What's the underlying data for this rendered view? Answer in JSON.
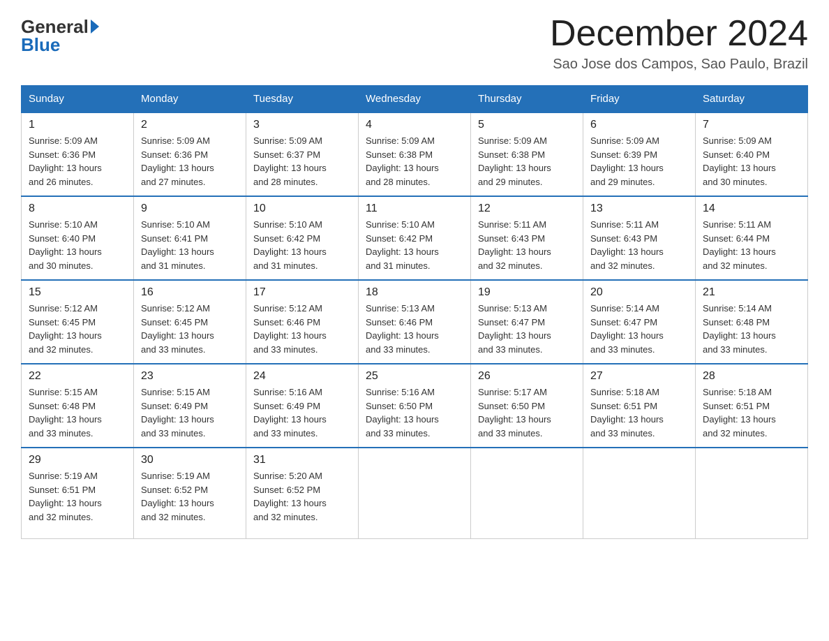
{
  "logo": {
    "text_general": "General",
    "text_blue": "Blue"
  },
  "header": {
    "month_title": "December 2024",
    "location": "Sao Jose dos Campos, Sao Paulo, Brazil"
  },
  "days_of_week": [
    "Sunday",
    "Monday",
    "Tuesday",
    "Wednesday",
    "Thursday",
    "Friday",
    "Saturday"
  ],
  "weeks": [
    [
      {
        "day": "1",
        "sunrise": "5:09 AM",
        "sunset": "6:36 PM",
        "daylight": "13 hours and 26 minutes."
      },
      {
        "day": "2",
        "sunrise": "5:09 AM",
        "sunset": "6:36 PM",
        "daylight": "13 hours and 27 minutes."
      },
      {
        "day": "3",
        "sunrise": "5:09 AM",
        "sunset": "6:37 PM",
        "daylight": "13 hours and 28 minutes."
      },
      {
        "day": "4",
        "sunrise": "5:09 AM",
        "sunset": "6:38 PM",
        "daylight": "13 hours and 28 minutes."
      },
      {
        "day": "5",
        "sunrise": "5:09 AM",
        "sunset": "6:38 PM",
        "daylight": "13 hours and 29 minutes."
      },
      {
        "day": "6",
        "sunrise": "5:09 AM",
        "sunset": "6:39 PM",
        "daylight": "13 hours and 29 minutes."
      },
      {
        "day": "7",
        "sunrise": "5:09 AM",
        "sunset": "6:40 PM",
        "daylight": "13 hours and 30 minutes."
      }
    ],
    [
      {
        "day": "8",
        "sunrise": "5:10 AM",
        "sunset": "6:40 PM",
        "daylight": "13 hours and 30 minutes."
      },
      {
        "day": "9",
        "sunrise": "5:10 AM",
        "sunset": "6:41 PM",
        "daylight": "13 hours and 31 minutes."
      },
      {
        "day": "10",
        "sunrise": "5:10 AM",
        "sunset": "6:42 PM",
        "daylight": "13 hours and 31 minutes."
      },
      {
        "day": "11",
        "sunrise": "5:10 AM",
        "sunset": "6:42 PM",
        "daylight": "13 hours and 31 minutes."
      },
      {
        "day": "12",
        "sunrise": "5:11 AM",
        "sunset": "6:43 PM",
        "daylight": "13 hours and 32 minutes."
      },
      {
        "day": "13",
        "sunrise": "5:11 AM",
        "sunset": "6:43 PM",
        "daylight": "13 hours and 32 minutes."
      },
      {
        "day": "14",
        "sunrise": "5:11 AM",
        "sunset": "6:44 PM",
        "daylight": "13 hours and 32 minutes."
      }
    ],
    [
      {
        "day": "15",
        "sunrise": "5:12 AM",
        "sunset": "6:45 PM",
        "daylight": "13 hours and 32 minutes."
      },
      {
        "day": "16",
        "sunrise": "5:12 AM",
        "sunset": "6:45 PM",
        "daylight": "13 hours and 33 minutes."
      },
      {
        "day": "17",
        "sunrise": "5:12 AM",
        "sunset": "6:46 PM",
        "daylight": "13 hours and 33 minutes."
      },
      {
        "day": "18",
        "sunrise": "5:13 AM",
        "sunset": "6:46 PM",
        "daylight": "13 hours and 33 minutes."
      },
      {
        "day": "19",
        "sunrise": "5:13 AM",
        "sunset": "6:47 PM",
        "daylight": "13 hours and 33 minutes."
      },
      {
        "day": "20",
        "sunrise": "5:14 AM",
        "sunset": "6:47 PM",
        "daylight": "13 hours and 33 minutes."
      },
      {
        "day": "21",
        "sunrise": "5:14 AM",
        "sunset": "6:48 PM",
        "daylight": "13 hours and 33 minutes."
      }
    ],
    [
      {
        "day": "22",
        "sunrise": "5:15 AM",
        "sunset": "6:48 PM",
        "daylight": "13 hours and 33 minutes."
      },
      {
        "day": "23",
        "sunrise": "5:15 AM",
        "sunset": "6:49 PM",
        "daylight": "13 hours and 33 minutes."
      },
      {
        "day": "24",
        "sunrise": "5:16 AM",
        "sunset": "6:49 PM",
        "daylight": "13 hours and 33 minutes."
      },
      {
        "day": "25",
        "sunrise": "5:16 AM",
        "sunset": "6:50 PM",
        "daylight": "13 hours and 33 minutes."
      },
      {
        "day": "26",
        "sunrise": "5:17 AM",
        "sunset": "6:50 PM",
        "daylight": "13 hours and 33 minutes."
      },
      {
        "day": "27",
        "sunrise": "5:18 AM",
        "sunset": "6:51 PM",
        "daylight": "13 hours and 33 minutes."
      },
      {
        "day": "28",
        "sunrise": "5:18 AM",
        "sunset": "6:51 PM",
        "daylight": "13 hours and 32 minutes."
      }
    ],
    [
      {
        "day": "29",
        "sunrise": "5:19 AM",
        "sunset": "6:51 PM",
        "daylight": "13 hours and 32 minutes."
      },
      {
        "day": "30",
        "sunrise": "5:19 AM",
        "sunset": "6:52 PM",
        "daylight": "13 hours and 32 minutes."
      },
      {
        "day": "31",
        "sunrise": "5:20 AM",
        "sunset": "6:52 PM",
        "daylight": "13 hours and 32 minutes."
      },
      null,
      null,
      null,
      null
    ]
  ],
  "labels": {
    "sunrise": "Sunrise:",
    "sunset": "Sunset:",
    "daylight": "Daylight:"
  }
}
